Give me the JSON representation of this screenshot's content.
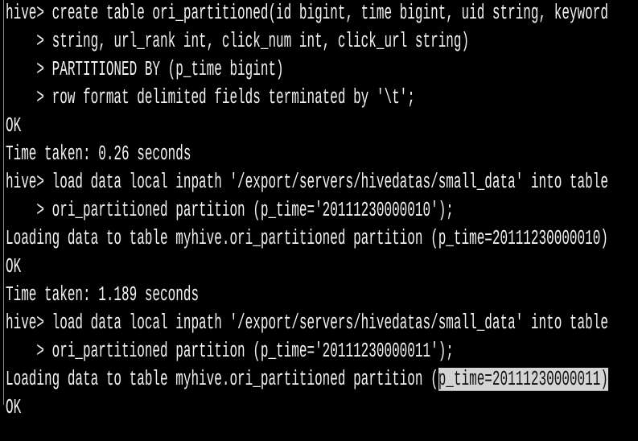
{
  "terminal": {
    "lines": [
      "hive> create table ori_partitioned(id bigint, time bigint, uid string, keyword",
      "    > string, url_rank int, click_num int, click_url string)",
      "    > PARTITIONED BY (p_time bigint)",
      "    > row format delimited fields terminated by '\\t';",
      "OK",
      "Time taken: 0.26 seconds",
      "hive> load data local inpath '/export/servers/hivedatas/small_data' into table",
      "    > ori_partitioned partition (p_time='20111230000010');",
      "Loading data to table myhive.ori_partitioned partition (p_time=20111230000010)",
      "OK",
      "Time taken: 1.189 seconds",
      "hive> load data local inpath '/export/servers/hivedatas/small_data' into table",
      "    > ori_partitioned partition (p_time='20111230000011');"
    ],
    "last_line_prefix": "Loading data to table myhive.ori_partitioned partition (",
    "last_line_selected": "p_time=20111230000011)",
    "trailing_line": "OK"
  }
}
